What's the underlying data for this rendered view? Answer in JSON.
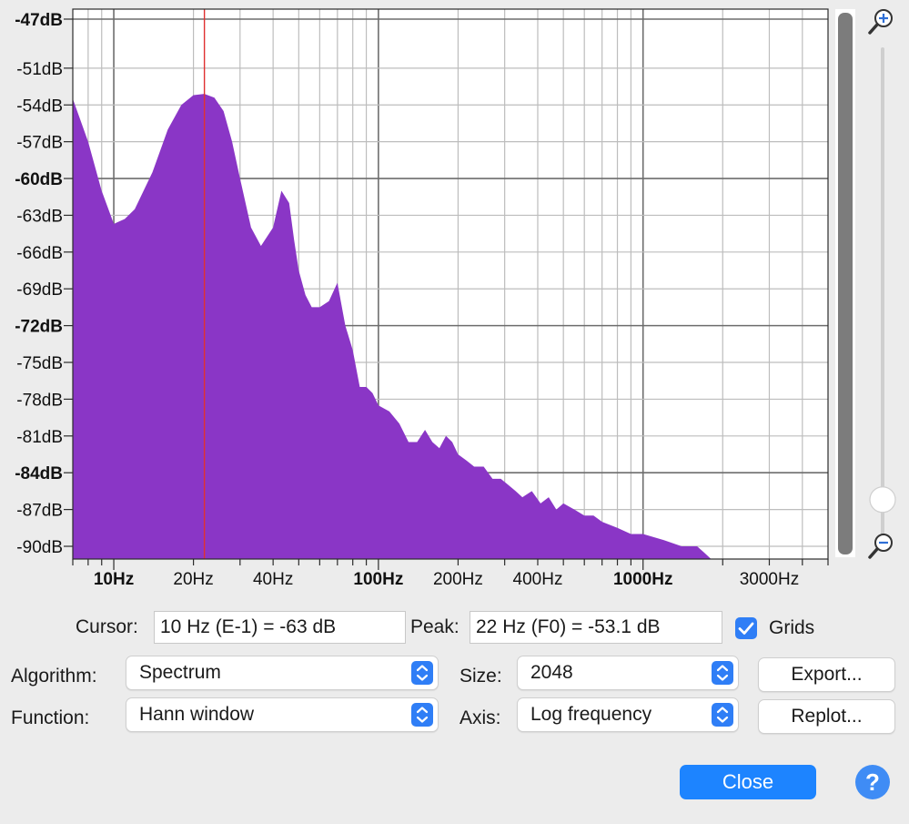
{
  "plot": {
    "db_labels": [
      "-47dB",
      "-51dB",
      "-54dB",
      "-57dB",
      "-60dB",
      "-63dB",
      "-66dB",
      "-69dB",
      "-72dB",
      "-75dB",
      "-78dB",
      "-81dB",
      "-84dB",
      "-87dB",
      "-90dB"
    ],
    "freq_labels": [
      "10Hz",
      "20Hz",
      "40Hz",
      "100Hz",
      "200Hz",
      "400Hz",
      "1000Hz",
      "3000Hz"
    ],
    "cursor_marker_hz": 22
  },
  "chart_data": {
    "type": "area",
    "xscale": "log",
    "xlim": [
      7,
      5000
    ],
    "ylim": [
      -90,
      -47
    ],
    "xlabel": "",
    "ylabel": "",
    "grid": true,
    "color": "#8a36c6",
    "x": [
      7,
      8,
      9,
      10,
      11,
      12,
      14,
      16,
      18,
      20,
      22,
      24,
      26,
      28,
      30,
      33,
      36,
      40,
      43,
      46,
      48,
      50,
      53,
      56,
      60,
      65,
      70,
      75,
      80,
      85,
      90,
      95,
      100,
      110,
      120,
      130,
      140,
      150,
      160,
      170,
      180,
      190,
      200,
      215,
      230,
      250,
      270,
      290,
      310,
      330,
      350,
      380,
      410,
      440,
      470,
      500,
      550,
      600,
      650,
      700,
      800,
      900,
      1000,
      1200,
      1400,
      1600,
      1700,
      1800,
      2500,
      4000
    ],
    "y": [
      -53.5,
      -57,
      -61,
      -63.7,
      -63.3,
      -62.5,
      -59.5,
      -56,
      -54,
      -53.2,
      -53.1,
      -53.4,
      -54.5,
      -57,
      -60,
      -64,
      -65.5,
      -64,
      -61,
      -62,
      -65,
      -67.5,
      -69.5,
      -70.5,
      -70.5,
      -70,
      -68.5,
      -72,
      -74,
      -77,
      -77,
      -77.5,
      -78.5,
      -79,
      -80,
      -81.5,
      -81.5,
      -80.5,
      -81.5,
      -82,
      -81,
      -81.5,
      -82.5,
      -83,
      -83.5,
      -83.5,
      -84.5,
      -84.5,
      -85,
      -85.5,
      -86,
      -85.5,
      -86.5,
      -86,
      -87,
      -86.5,
      -87,
      -87.5,
      -87.5,
      -88,
      -88.5,
      -89,
      -89,
      -89.5,
      -90,
      -90,
      -90.5,
      -91,
      -91,
      -91
    ]
  },
  "controls": {
    "cursor_label": "Cursor:",
    "cursor_value": "10 Hz (E-1) = -63 dB",
    "peak_label": "Peak:",
    "peak_value": "22 Hz (F0) = -53.1 dB",
    "grids_label": "Grids",
    "grids_checked": true,
    "algorithm_label": "Algorithm:",
    "algorithm_value": "Spectrum",
    "function_label": "Function:",
    "function_value": "Hann window",
    "size_label": "Size:",
    "size_value": "2048",
    "axis_label": "Axis:",
    "axis_value": "Log frequency",
    "export_label": "Export...",
    "replot_label": "Replot...",
    "close_label": "Close",
    "help_label": "?"
  },
  "zoom": {
    "slider_position": 0.93
  },
  "colors": {
    "accent": "#2f7ef6",
    "spectrum": "#8a36c6",
    "cursor_line": "#e03030",
    "close_button": "#1d84ff"
  }
}
